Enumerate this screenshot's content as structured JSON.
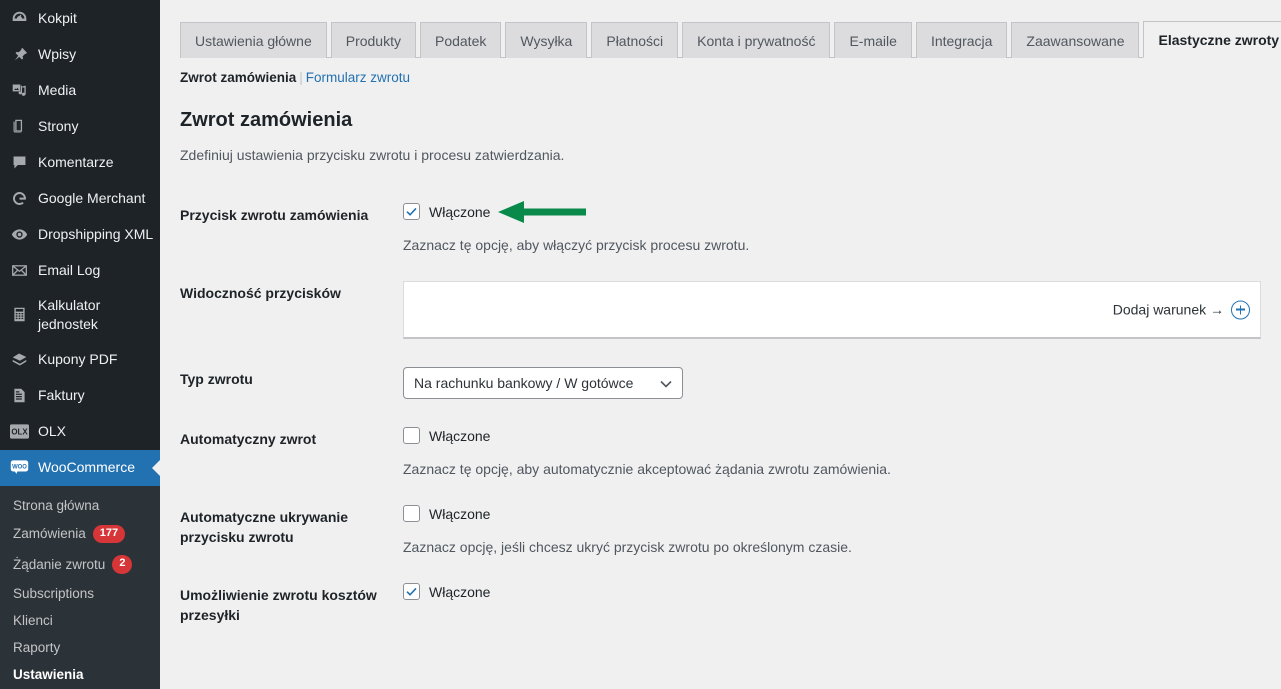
{
  "sidebar": {
    "items": [
      {
        "label": "Kokpit",
        "icon": "dashboard-icon"
      },
      {
        "label": "Wpisy",
        "icon": "pin-icon"
      },
      {
        "label": "Media",
        "icon": "media-icon"
      },
      {
        "label": "Strony",
        "icon": "pages-icon"
      },
      {
        "label": "Komentarze",
        "icon": "comments-icon"
      },
      {
        "label": "Google Merchant",
        "icon": "google-icon"
      },
      {
        "label": "Dropshipping XML",
        "icon": "eye-icon"
      },
      {
        "label": "Email Log",
        "icon": "envelope-icon"
      },
      {
        "label": "Kalkulator jednostek",
        "icon": "calculator-icon"
      },
      {
        "label": "Kupony PDF",
        "icon": "ticket-icon"
      },
      {
        "label": "Faktury",
        "icon": "document-icon"
      },
      {
        "label": "OLX",
        "icon": "olx-icon"
      }
    ],
    "active_item": {
      "label": "WooCommerce",
      "icon": "woocommerce-icon"
    },
    "submenu": [
      {
        "label": "Strona główna",
        "badge": ""
      },
      {
        "label": "Zamówienia",
        "badge": "177"
      },
      {
        "label": "Żądanie zwrotu",
        "badge": "2"
      },
      {
        "label": "Subscriptions",
        "badge": ""
      },
      {
        "label": "Klienci",
        "badge": ""
      },
      {
        "label": "Raporty",
        "badge": ""
      },
      {
        "label": "Ustawienia",
        "badge": "",
        "current": true
      }
    ]
  },
  "tabs": [
    {
      "label": "Ustawienia główne",
      "active": false
    },
    {
      "label": "Produkty",
      "active": false
    },
    {
      "label": "Podatek",
      "active": false
    },
    {
      "label": "Wysyłka",
      "active": false
    },
    {
      "label": "Płatności",
      "active": false
    },
    {
      "label": "Konta i prywatność",
      "active": false
    },
    {
      "label": "E-maile",
      "active": false
    },
    {
      "label": "Integracja",
      "active": false
    },
    {
      "label": "Zaawansowane",
      "active": false
    },
    {
      "label": "Elastyczne zwroty",
      "active": true
    }
  ],
  "subnav": {
    "current": "Zwrot zamówienia",
    "separator": "|",
    "link": "Formularz zwrotu"
  },
  "page": {
    "title": "Zwrot zamówienia",
    "description": "Zdefiniuj ustawienia przycisku zwrotu i procesu zatwierdzania."
  },
  "fields": {
    "refund_button": {
      "label": "Przycisk zwrotu zamówienia",
      "checkbox_label": "Włączone",
      "checked": true,
      "description": "Zaznacz tę opcję, aby włączyć przycisk procesu zwrotu."
    },
    "button_visibility": {
      "label": "Widoczność przycisków",
      "add_condition_label": "Dodaj warunek →",
      "add_condition_icon": "plus-circle-icon"
    },
    "refund_type": {
      "label": "Typ zwrotu",
      "value": "Na rachunku bankowy / W gotówce",
      "options": [
        "Na rachunku bankowy / W gotówce"
      ]
    },
    "auto_refund": {
      "label": "Automatyczny zwrot",
      "checkbox_label": "Włączone",
      "checked": false,
      "description": "Zaznacz tę opcję, aby automatycznie akceptować żądania zwrotu zamówienia."
    },
    "auto_hide": {
      "label": "Automatyczne ukrywanie przycisku zwrotu",
      "checkbox_label": "Włączone",
      "checked": false,
      "description": "Zaznacz opcję, jeśli chcesz ukryć przycisk zwrotu po określonym czasie."
    },
    "shipping_refund": {
      "label": "Umożliwienie zwrotu kosztów przesyłki",
      "checkbox_label": "Włączone",
      "checked": true,
      "description": ""
    }
  },
  "annotation": {
    "arrow_color": "#0a8a4a",
    "points_at": "refund-button-checkbox"
  },
  "colors": {
    "sidebar_bg": "#1d2327",
    "submenu_bg": "#2c3338",
    "accent_blue": "#2271b1",
    "badge_red": "#d63638",
    "page_bg": "#f0f0f1"
  }
}
